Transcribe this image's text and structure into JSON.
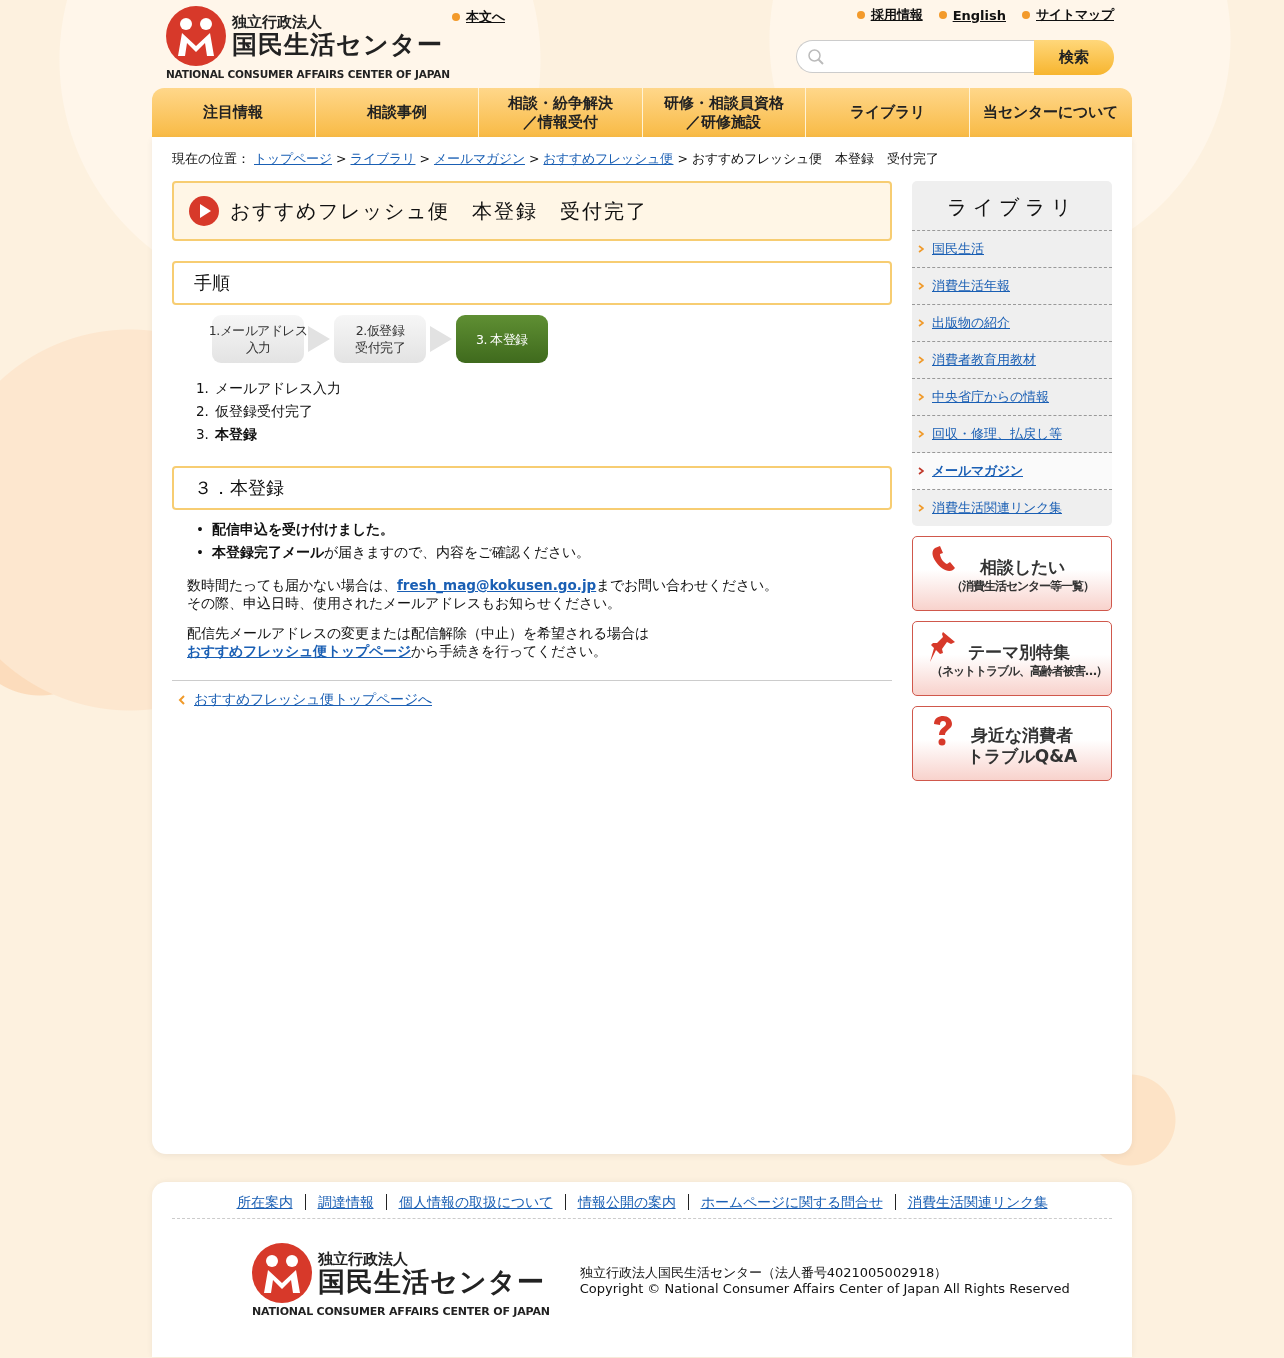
{
  "header": {
    "logo": {
      "org_type": "独立行政法人",
      "name": "国民生活センター",
      "english": "NATIONAL CONSUMER AFFAIRS CENTER OF JAPAN"
    },
    "skip_link": "本文へ",
    "utility_links": [
      "採用情報",
      "English",
      "サイトマップ"
    ],
    "search": {
      "button": "検索"
    }
  },
  "nav": [
    {
      "lines": [
        "注目情報"
      ]
    },
    {
      "lines": [
        "相談事例"
      ]
    },
    {
      "lines": [
        "相談・紛争解決",
        "／情報受付"
      ]
    },
    {
      "lines": [
        "研修・相談員資格",
        "／研修施設"
      ]
    },
    {
      "lines": [
        "ライブラリ"
      ]
    },
    {
      "lines": [
        "当センターについて"
      ]
    }
  ],
  "breadcrumb": {
    "label": "現在の位置：",
    "separator": ">",
    "links": [
      "トップページ",
      "ライブラリ",
      "メールマガジン",
      "おすすめフレッシュ便"
    ],
    "current": "おすすめフレッシュ便　本登録　受付完了"
  },
  "page_title": "おすすめフレッシュ便　本登録　受付完了",
  "procedure": {
    "heading": "手順",
    "steps": [
      {
        "lines": [
          "1.メールアドレス",
          "入力"
        ],
        "current": false
      },
      {
        "lines": [
          "2.仮登録",
          "受付完了"
        ],
        "current": false
      },
      {
        "lines": [
          "3. 本登録"
        ],
        "current": true
      }
    ],
    "list": [
      {
        "number": "1.",
        "text": "メールアドレス入力",
        "current": false
      },
      {
        "number": "2.",
        "text": "仮登録受付完了",
        "current": false
      },
      {
        "number": "3.",
        "text": "本登録",
        "current": true
      }
    ]
  },
  "section": {
    "heading": "３．本登録",
    "bullets": [
      {
        "marker": "•",
        "text": "配信申込を受け付けました。",
        "bold": true
      },
      {
        "marker": "•",
        "text": "**本登録完了メール**が届きますので、内容をご確認ください。",
        "bold": false
      }
    ],
    "paragraphs": [
      {
        "lines": [
          [
            {
              "kind": "text",
              "text": "数時間たっても届かない場合は、"
            },
            {
              "kind": "link",
              "text": "fresh_mag@kokusen.go.jp"
            },
            {
              "kind": "text",
              "text": "までお問い合わせください。"
            }
          ],
          [
            {
              "kind": "text",
              "text": "その際、申込日時、使用されたメールアドレスもお知らせください。"
            }
          ]
        ]
      },
      {
        "lines": [
          [
            {
              "kind": "text",
              "text": "配信先メールアドレスの変更または配信解除（中止）を希望される場合は"
            }
          ],
          [
            {
              "kind": "link",
              "text": "おすすめフレッシュ便トップページ"
            },
            {
              "kind": "text",
              "text": "から手続きを行ってください。"
            }
          ]
        ]
      }
    ],
    "back_link": "おすすめフレッシュ便トップページへ"
  },
  "sidebar": {
    "heading": "ライブラリ",
    "items": [
      {
        "label": "国民生活",
        "selected": false
      },
      {
        "label": "消費生活年報",
        "selected": false
      },
      {
        "label": "出版物の紹介",
        "selected": false
      },
      {
        "label": "消費者教育用教材",
        "selected": false
      },
      {
        "label": "中央省庁からの情報",
        "selected": false
      },
      {
        "label": "回収・修理、払戻し等",
        "selected": false
      },
      {
        "label": "メールマガジン",
        "selected": true
      },
      {
        "label": "消費生活関連リンク集",
        "selected": false
      }
    ],
    "banners": [
      {
        "kind": "phone",
        "title": "相談したい",
        "subtitle": "（消費生活センター等一覧）"
      },
      {
        "kind": "pin",
        "title": "テーマ別特集",
        "subtitle": "（ネットトラブル、高齢者被害…）"
      },
      {
        "kind": "question",
        "title": "身近な消費者",
        "subtitle": "トラブルQ&A"
      }
    ]
  },
  "footer": {
    "links": [
      "所在案内",
      "調達情報",
      "個人情報の取扱について",
      "情報公開の案内",
      "ホームページに関する問合せ",
      "消費生活関連リンク集"
    ],
    "logo": {
      "org_type": "独立行政法人",
      "name": "国民生活センター",
      "english": "NATIONAL CONSUMER AFFAIRS CENTER OF JAPAN"
    },
    "org_line": "独立行政法人国民生活センター（法人番号4021005002918）",
    "copyright": "Copyright © National Consumer Affairs Center of Japan All Rights Reserved"
  }
}
